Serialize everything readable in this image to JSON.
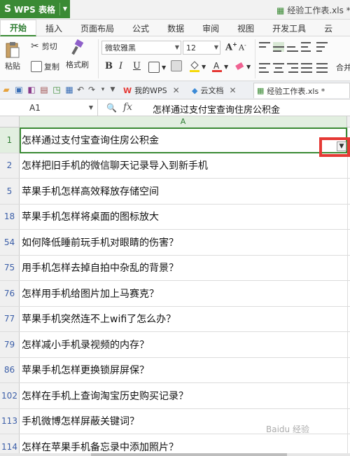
{
  "app": {
    "name": "WPS 表格",
    "doc_title": "经验工作表.xls *"
  },
  "ribbon_tabs": [
    "开始",
    "插入",
    "页面布局",
    "公式",
    "数据",
    "审阅",
    "视图",
    "开发工具",
    "云"
  ],
  "ribbon": {
    "paste": "粘贴",
    "cut": "剪切",
    "copy": "复制",
    "format_painter": "格式刷",
    "font_name": "微软雅黑",
    "font_size": "12",
    "bold": "B",
    "italic": "I",
    "underline": "U",
    "grow_font": "A",
    "shrink_font": "A",
    "merge": "合并"
  },
  "doc_tabs": [
    {
      "label": "我的WPS"
    },
    {
      "label": "云文档"
    },
    {
      "label": "经验工作表.xls *"
    }
  ],
  "formula_bar": {
    "cell_ref": "A1",
    "fx": "fx",
    "value": "怎样通过支付宝查询住房公积金"
  },
  "columns": [
    "A"
  ],
  "rows": [
    {
      "num": "1",
      "text": "怎样通过支付宝查询住房公积金"
    },
    {
      "num": "2",
      "text": "怎样把旧手机的微信聊天记录导入到新手机"
    },
    {
      "num": "5",
      "text": "苹果手机怎样高效释放存储空间"
    },
    {
      "num": "18",
      "text": "苹果手机怎样将桌面的图标放大"
    },
    {
      "num": "54",
      "text": "如何降低睡前玩手机对眼睛的伤害？"
    },
    {
      "num": "75",
      "text": "用手机怎样去掉自拍中杂乱的背景？"
    },
    {
      "num": "76",
      "text": "怎样用手机给图片加上马赛克？"
    },
    {
      "num": "77",
      "text": "苹果手机突然连不上wifi了怎么办？"
    },
    {
      "num": "79",
      "text": "怎样减小手机录视频的内存？"
    },
    {
      "num": "86",
      "text": "苹果手机怎样更换锁屏屏保？"
    },
    {
      "num": "102",
      "text": "怎样在手机上查询淘宝历史购买记录？"
    },
    {
      "num": "113",
      "text": "手机微博怎样屏蔽关键词？"
    },
    {
      "num": "114",
      "text": "怎样在苹果手机备忘录中添加照片？"
    }
  ],
  "watermark": "Baidu 经验"
}
